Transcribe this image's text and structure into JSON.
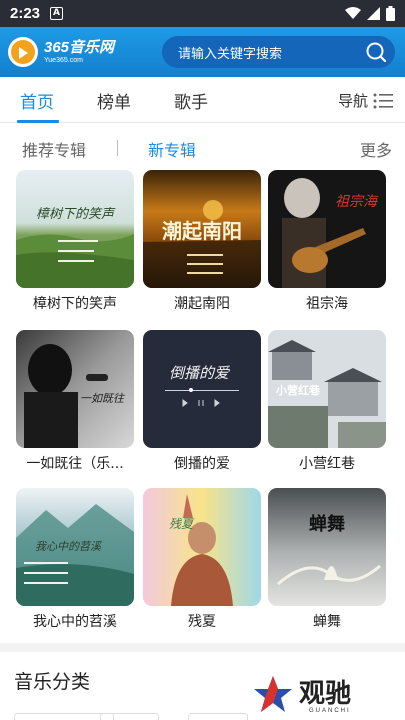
{
  "status_bar": {
    "time": "2:23",
    "notification_letter": "A"
  },
  "header": {
    "logo_main": "365音乐网",
    "logo_sub": "Yue365.com",
    "search_placeholder": "请输入关键字搜索"
  },
  "main_tabs": [
    {
      "label": "首页",
      "active": true
    },
    {
      "label": "榜单",
      "active": false
    },
    {
      "label": "歌手",
      "active": false
    }
  ],
  "nav_menu": {
    "label": "导航"
  },
  "sub_tabs": [
    {
      "label": "推荐专辑",
      "active": false
    },
    {
      "label": "新专辑",
      "active": true
    }
  ],
  "more_label": "更多",
  "albums": [
    {
      "title": "樟树下的笑声",
      "cover_text": "樟树下的笑声"
    },
    {
      "title": "潮起南阳",
      "cover_text": "潮起南阳"
    },
    {
      "title": "祖宗海",
      "cover_text": "祖宗海"
    },
    {
      "title": "一如既往（乐...",
      "cover_text": "一如既往"
    },
    {
      "title": "倒播的爱",
      "cover_text": "倒播的爱"
    },
    {
      "title": "小营红巷",
      "cover_text": "小营红巷"
    },
    {
      "title": "我心中的苕溪",
      "cover_text": "我心中的苕溪"
    },
    {
      "title": "残夏",
      "cover_text": "残夏"
    },
    {
      "title": "蝉舞",
      "cover_text": "蝉舞"
    }
  ],
  "section": {
    "title": "音乐分类"
  },
  "watermark": {
    "text": "观驰",
    "sub": "GUANCHI"
  },
  "colors": {
    "accent": "#1a8be3",
    "header": "#1a8ee0",
    "status_bar": "#2a2d35"
  }
}
